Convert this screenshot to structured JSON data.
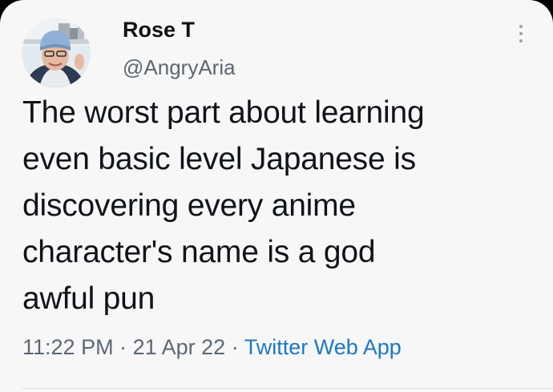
{
  "tweet": {
    "author": {
      "display_name": "Rose T",
      "handle": "@AngryAria"
    },
    "text_lines": [
      "The worst part about learning",
      "even basic level Japanese is",
      "discovering every anime",
      "character's name is a god",
      "awful pun"
    ],
    "time": "11:22 PM",
    "separator": "·",
    "date": "21 Apr 22",
    "source": "Twitter Web App",
    "menu_icon": "more-vertical-icon"
  },
  "colors": {
    "background": "#f7f7f7",
    "text": "#0f1419",
    "muted": "#5b6873",
    "link": "#1d77c2"
  }
}
